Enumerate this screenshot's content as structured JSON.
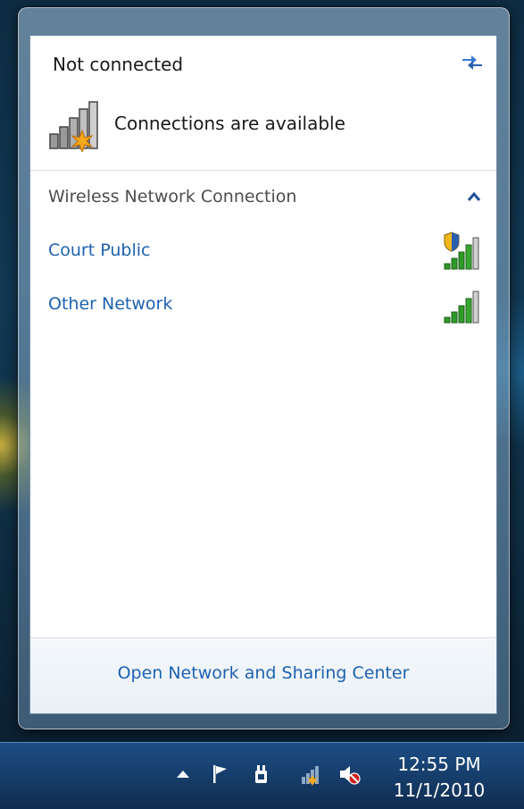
{
  "flyout": {
    "status_title": "Not connected",
    "available_text": "Connections are available",
    "section_title": "Wireless Network Connection",
    "networks": [
      {
        "name": "Court Public",
        "secured": true,
        "signal_bars": 5
      },
      {
        "name": "Other Network",
        "secured": false,
        "signal_bars": 5
      }
    ],
    "footer_link": "Open Network and Sharing Center"
  },
  "taskbar": {
    "tray_icons": [
      "show-hidden-icons-arrow",
      "action-center-flag-icon",
      "power-plug-icon",
      "network-no-connection-icon",
      "volume-muted-icon"
    ],
    "clock_time": "12:55 PM",
    "clock_date": "11/1/2010"
  },
  "colors": {
    "link": "#1e62b0",
    "signal_green": "#2e9a28",
    "taskbar": "#173f6e"
  }
}
